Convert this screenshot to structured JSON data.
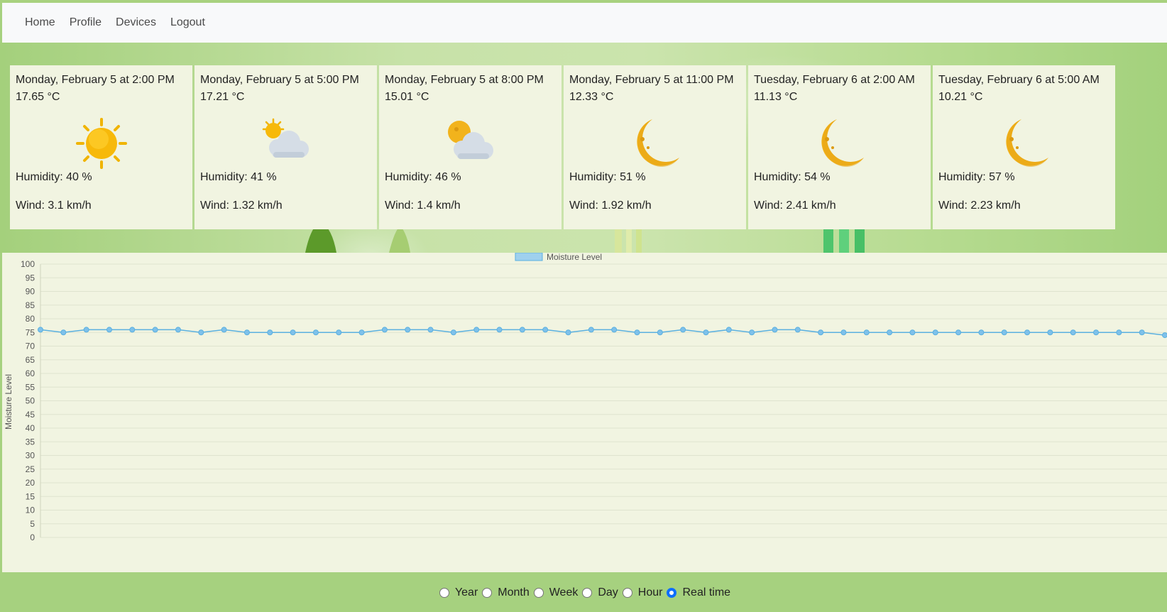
{
  "nav": {
    "home": "Home",
    "profile": "Profile",
    "devices": "Devices",
    "logout": "Logout"
  },
  "forecast": [
    {
      "datetime": "Monday, February 5 at 2:00 PM",
      "temp": "17.65 °C",
      "icon": "sun-icon",
      "humidity": "Humidity: 40 %",
      "wind": "Wind: 3.1 km/h"
    },
    {
      "datetime": "Monday, February 5 at 5:00 PM",
      "temp": "17.21 °C",
      "icon": "sun-behind-cloud-icon",
      "humidity": "Humidity: 41 %",
      "wind": "Wind: 1.32 km/h"
    },
    {
      "datetime": "Monday, February 5 at 8:00 PM",
      "temp": "15.01 °C",
      "icon": "moon-behind-cloud-icon",
      "humidity": "Humidity: 46 %",
      "wind": "Wind: 1.4 km/h"
    },
    {
      "datetime": "Monday, February 5 at 11:00 PM",
      "temp": "12.33 °C",
      "icon": "crescent-moon-icon",
      "humidity": "Humidity: 51 %",
      "wind": "Wind: 1.92 km/h"
    },
    {
      "datetime": "Tuesday, February 6 at 2:00 AM",
      "temp": "11.13 °C",
      "icon": "crescent-moon-icon",
      "humidity": "Humidity: 54 %",
      "wind": "Wind: 2.41 km/h"
    },
    {
      "datetime": "Tuesday, February 6 at 5:00 AM",
      "temp": "10.21 °C",
      "icon": "crescent-moon-icon",
      "humidity": "Humidity: 57 %",
      "wind": "Wind: 2.23 km/h"
    }
  ],
  "chart_data": {
    "type": "line",
    "legend": "Moisture Level",
    "ylabel": "Moisture Level",
    "ylim": [
      0,
      100
    ],
    "ystep": 5,
    "grid": true,
    "legend_position": "top",
    "color": "#5ab0e0",
    "series": [
      {
        "name": "Moisture Level",
        "values": [
          76,
          75,
          76,
          76,
          76,
          76,
          76,
          75,
          76,
          75,
          75,
          75,
          75,
          75,
          75,
          76,
          76,
          76,
          75,
          76,
          76,
          76,
          76,
          75,
          76,
          76,
          75,
          75,
          76,
          75,
          76,
          75,
          76,
          76,
          75,
          75,
          75,
          75,
          75,
          75,
          75,
          75,
          75,
          75,
          75,
          75,
          75,
          75,
          75,
          74
        ]
      }
    ]
  },
  "range": {
    "options": [
      "Year",
      "Month",
      "Week",
      "Day",
      "Hour",
      "Real time"
    ],
    "selected": "Real time"
  }
}
